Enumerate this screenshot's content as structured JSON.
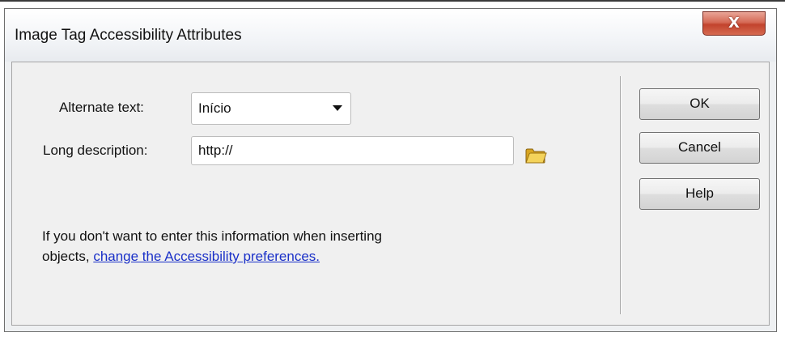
{
  "dialog": {
    "title": "Image Tag Accessibility Attributes",
    "close_label": "X"
  },
  "form": {
    "alt_text_label": "Alternate text:",
    "alt_text_value": "Início",
    "long_desc_label": "Long description:",
    "long_desc_value": "http://",
    "info_text": "If you don't want to enter this information when inserting",
    "info_text_2": "objects, ",
    "info_link": "change the Accessibility preferences."
  },
  "buttons": {
    "ok": "OK",
    "cancel": "Cancel",
    "help": "Help"
  },
  "colors": {
    "link": "#1a30c8",
    "close_button": "#c2432d"
  },
  "icons": {
    "browse": "folder-icon",
    "dropdown": "chevron-down-icon"
  }
}
